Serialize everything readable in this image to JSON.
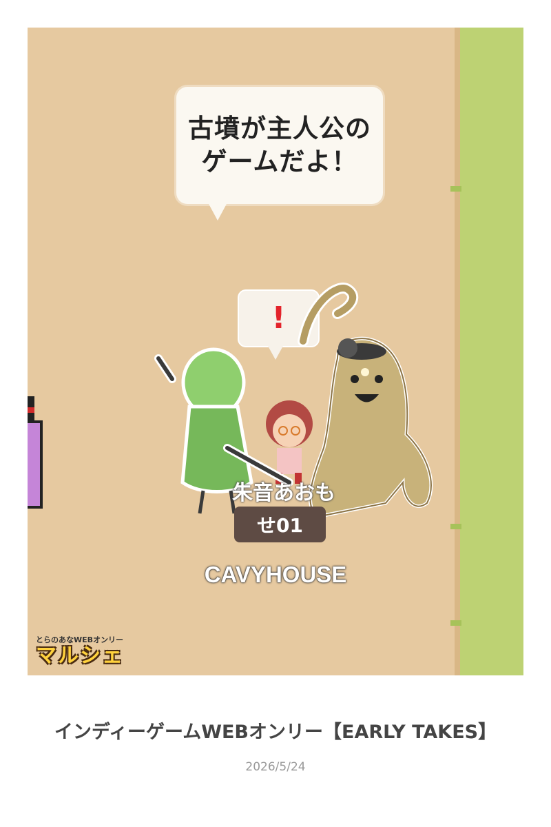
{
  "speech": {
    "line1": "古墳が主人公の",
    "line2": "ゲームだよ！"
  },
  "alert_mark": "!",
  "player": {
    "name_line1": "朱音あおも",
    "name_line2": "せ01"
  },
  "booth_label": "CAVYHOUSE",
  "logo": {
    "small": "とらのあなWEBオンリー",
    "big": "マルシェ"
  },
  "post": {
    "title": "インディーゲームWEBオンリー【EARLY TAKES】",
    "date": "2026/5/24"
  },
  "colors": {
    "ground": "#e6c9a0",
    "grass": "#bdd273",
    "green_character": "#8fcf6e",
    "haniwa_character": "#c8b27a"
  }
}
